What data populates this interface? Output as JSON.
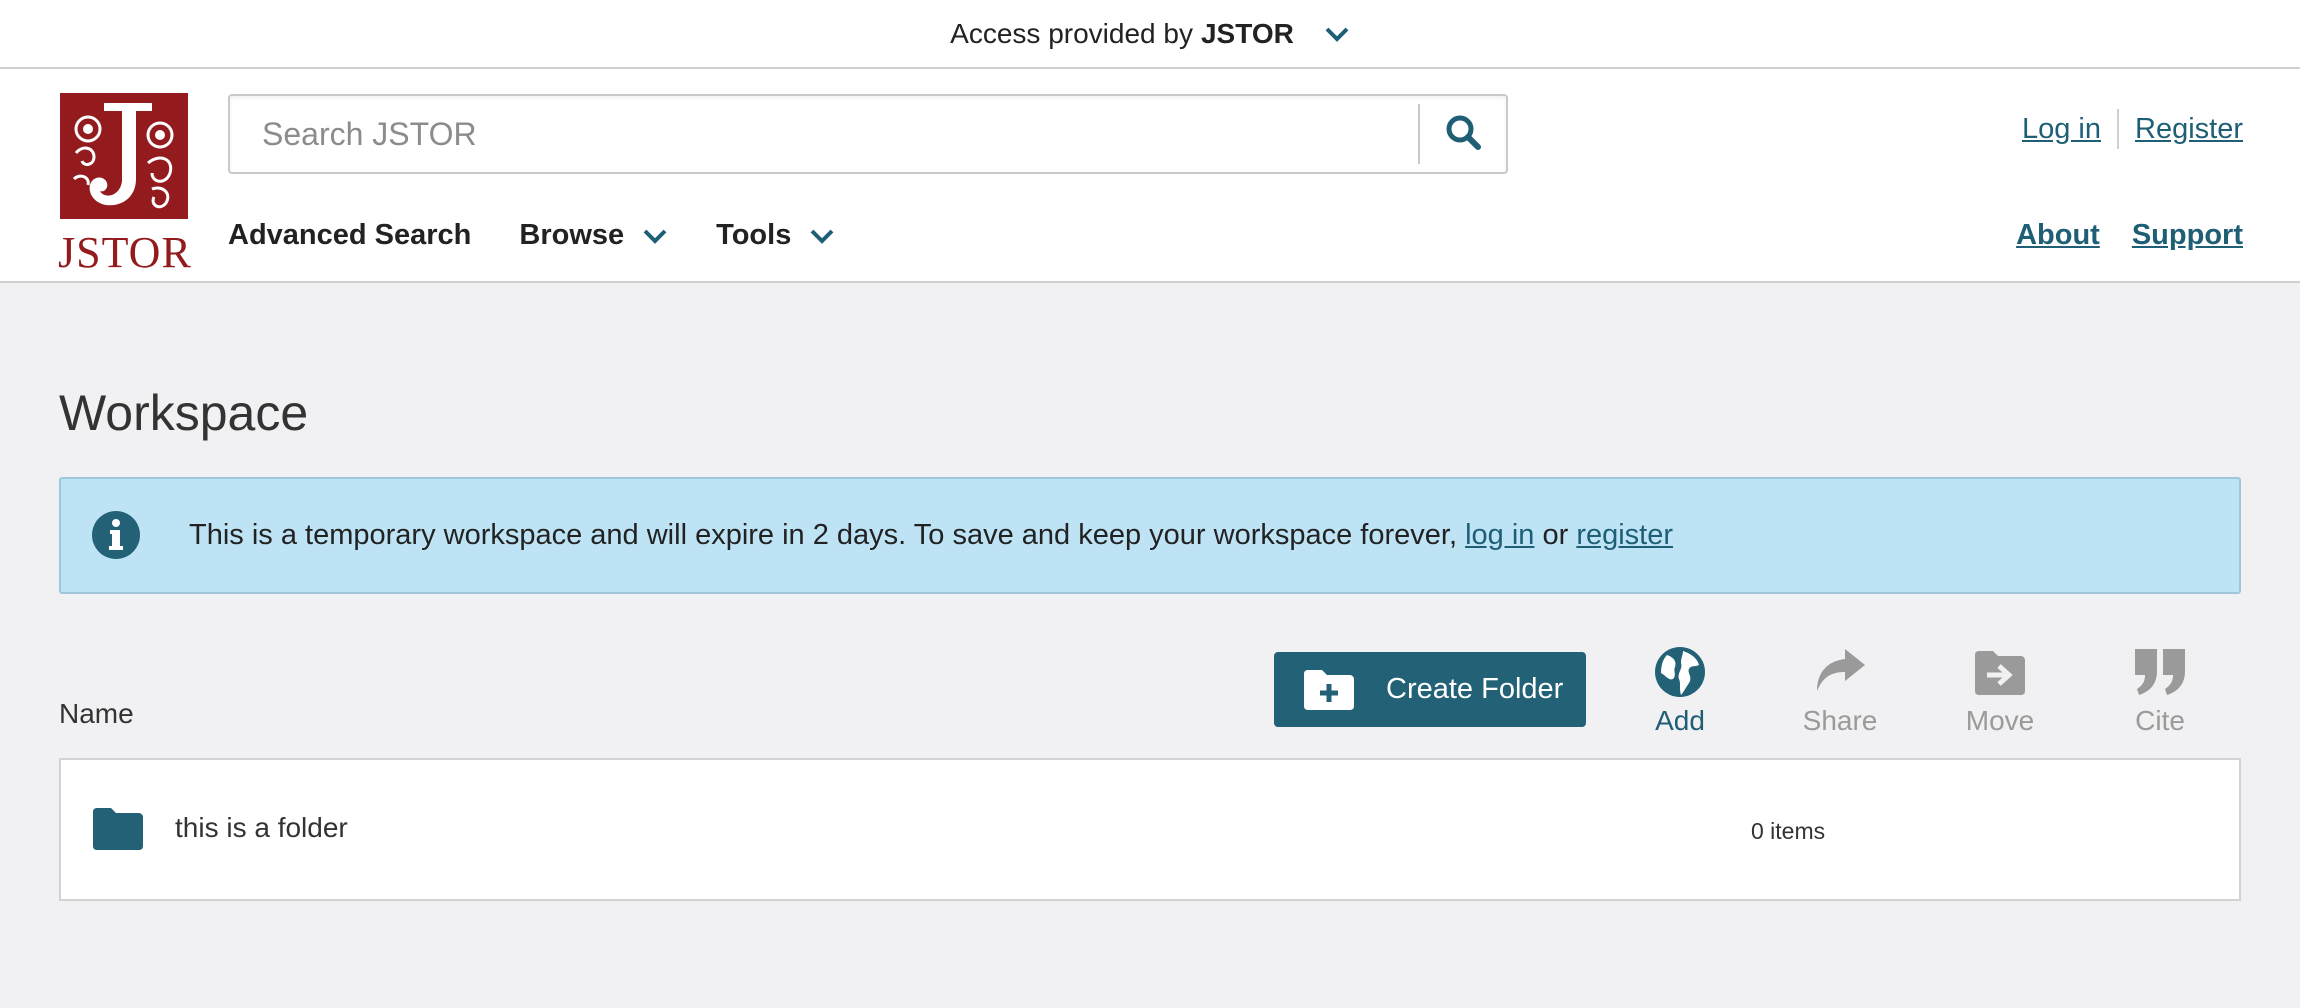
{
  "access_bar": {
    "prefix": "Access provided by",
    "org": "JSTOR"
  },
  "logo": {
    "word": "JSTOR"
  },
  "search": {
    "placeholder": "Search JSTOR"
  },
  "auth": {
    "login": "Log in",
    "register": "Register"
  },
  "nav": {
    "advanced_search": "Advanced Search",
    "browse": "Browse",
    "tools": "Tools"
  },
  "subnav": {
    "about": "About",
    "support": "Support"
  },
  "main": {
    "title": "Workspace",
    "alert": {
      "text": "This is a temporary workspace and will expire in 2 days. To save and keep your workspace forever,",
      "login_link": "log in",
      "or": "or",
      "register_link": "register"
    },
    "name_label": "Name",
    "create_folder": "Create Folder",
    "tools": {
      "add": "Add",
      "share": "Share",
      "move": "Move",
      "cite": "Cite"
    },
    "folders": [
      {
        "name": "this is a folder",
        "count": "0 items"
      }
    ]
  },
  "colors": {
    "brand_teal": "#236176",
    "link": "#1e5f75",
    "logo_red": "#931b1d",
    "alert_bg": "#bde3f5",
    "disabled": "#9a9a9a"
  },
  "icons": [
    "chevron-down-icon",
    "search-icon",
    "info-icon",
    "folder-plus-icon",
    "globe-icon",
    "share-icon",
    "move-icon",
    "quote-icon",
    "folder-icon"
  ]
}
